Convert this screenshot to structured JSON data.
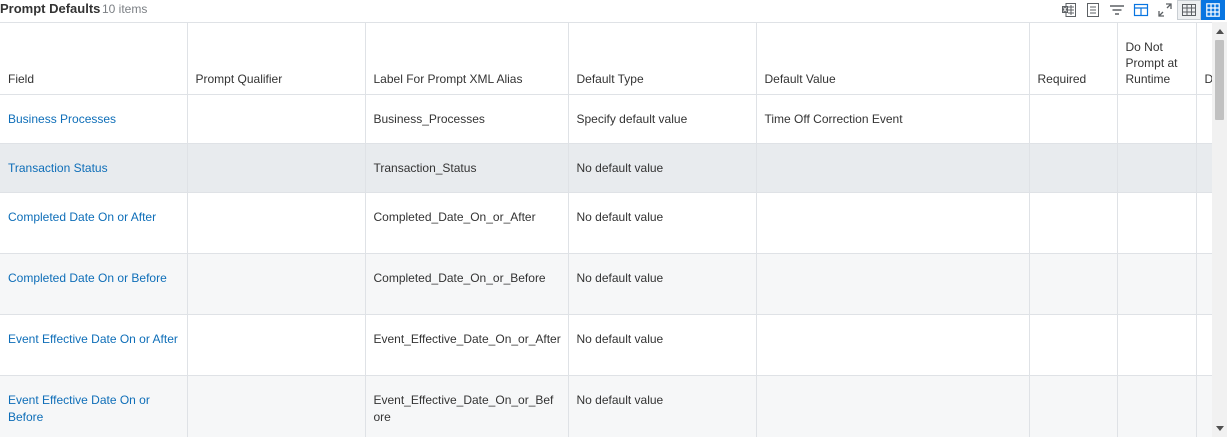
{
  "header": {
    "title": "Prompt Defaults",
    "count": "10 items"
  },
  "toolbar": {
    "icons": [
      "export-excel-icon",
      "export-pdf-icon",
      "filter-icon",
      "columns-icon",
      "fullscreen-icon",
      "table-view-icon",
      "grid-view-icon"
    ],
    "accent": "#0875e1"
  },
  "columns": [
    {
      "label": "Field"
    },
    {
      "label": "Prompt Qualifier"
    },
    {
      "label": "Label For Prompt XML Alias"
    },
    {
      "label": "Default Type"
    },
    {
      "label": "Default Value"
    },
    {
      "label": "Required"
    },
    {
      "label": "Do Not Prompt at Runtime"
    },
    {
      "label": "D I S"
    }
  ],
  "rows": [
    {
      "field": "Business Processes",
      "qualifier": "",
      "alias": "Business_Processes",
      "type": "Specify default value",
      "value": "Time Off Correction Event",
      "required": "",
      "noprompt": "",
      "extra": ""
    },
    {
      "field": "Transaction Status",
      "qualifier": "",
      "alias": "Transaction_Status",
      "type": "No default value",
      "value": "",
      "required": "",
      "noprompt": "",
      "extra": ""
    },
    {
      "field": "Completed Date On or After",
      "qualifier": "",
      "alias": "Completed_Date_On_or_After",
      "type": "No default value",
      "value": "",
      "required": "",
      "noprompt": "",
      "extra": ""
    },
    {
      "field": "Completed Date On or Before",
      "qualifier": "",
      "alias": "Completed_Date_On_or_Before",
      "type": "No default value",
      "value": "",
      "required": "",
      "noprompt": "",
      "extra": ""
    },
    {
      "field": "Event Effective Date On or After",
      "qualifier": "",
      "alias": "Event_Effective_Date_On_or_After",
      "type": "No default value",
      "value": "",
      "required": "",
      "noprompt": "",
      "extra": ""
    },
    {
      "field": "Event Effective Date On or Before",
      "qualifier": "",
      "alias": "Event_Effective_Date_On_or_Before",
      "type": "No default value",
      "value": "",
      "required": "",
      "noprompt": "",
      "extra": ""
    }
  ]
}
